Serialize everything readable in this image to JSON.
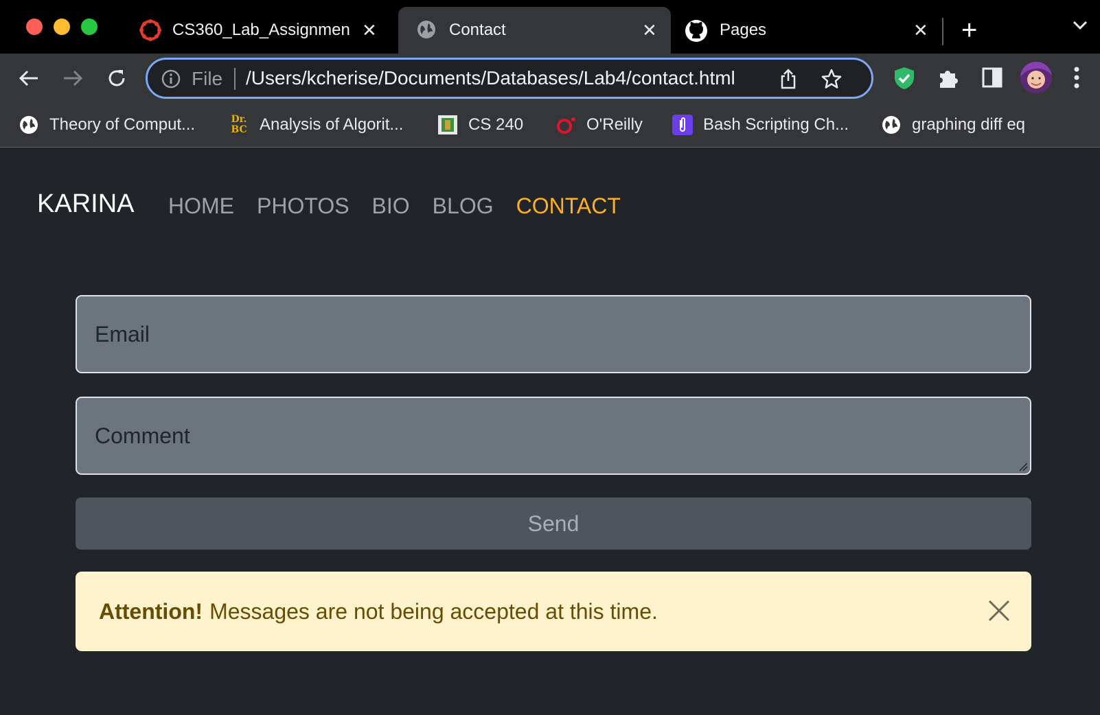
{
  "browser": {
    "tabs": [
      {
        "title": "CS360_Lab_Assignmen",
        "icon": "canvas-logo-icon"
      },
      {
        "title": "Contact",
        "icon": "globe-icon"
      },
      {
        "title": "Pages",
        "icon": "github-icon"
      }
    ],
    "new_tab_label": "+",
    "address": {
      "scheme_label": "File",
      "url": "/Users/kcherise/Documents/Databases/Lab4/contact.html"
    },
    "bookmarks": [
      {
        "label": "Theory of Comput...",
        "icon": "globe-icon"
      },
      {
        "label": "Analysis of Algorit...",
        "icon": "drbc-icon",
        "icon_text_top": "Dr.",
        "icon_text_bottom": "BC"
      },
      {
        "label": "CS 240",
        "icon": "chip-icon"
      },
      {
        "label": "O'Reilly",
        "icon": "oreilly-icon"
      },
      {
        "label": "Bash Scripting Ch...",
        "icon": "paperclip-icon"
      },
      {
        "label": "graphing diff eq",
        "icon": "globe-icon"
      }
    ],
    "accent": "#7ca8f5"
  },
  "site": {
    "brand": "KARINA",
    "nav": [
      "HOME",
      "PHOTOS",
      "BIO",
      "BLOG",
      "CONTACT"
    ],
    "active_nav": "CONTACT",
    "active_color": "#ffb020"
  },
  "form": {
    "email_placeholder": "Email",
    "comment_placeholder": "Comment",
    "send_label": "Send"
  },
  "alert": {
    "strong": "Attention!",
    "message": "Messages are not being accepted at this time.",
    "close_icon": "close-icon"
  }
}
